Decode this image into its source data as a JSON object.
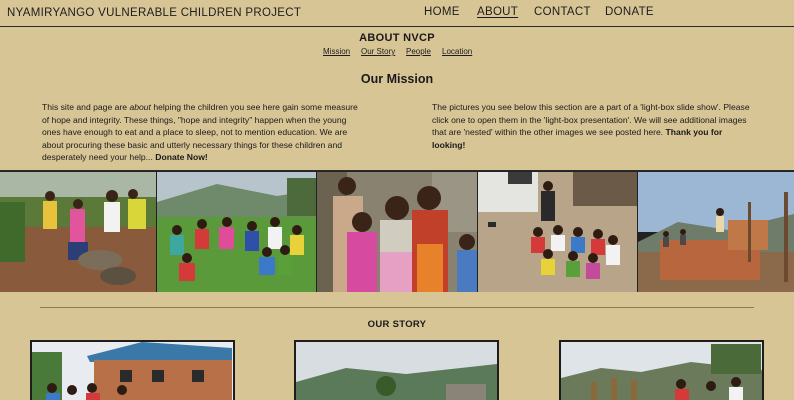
{
  "header": {
    "site_title": "NYAMIRYANGO VULNERABLE CHILDREN PROJECT",
    "nav": [
      {
        "label": "HOME",
        "active": false
      },
      {
        "label": "ABOUT",
        "active": true
      },
      {
        "label": "CONTACT",
        "active": false
      },
      {
        "label": "DONATE",
        "active": false
      }
    ]
  },
  "about": {
    "title": "ABOUT NVCP",
    "subnav": [
      "Mission",
      "Our Story",
      "People",
      "Location"
    ]
  },
  "mission": {
    "title": "Our Mission",
    "left_text_1": "This site and page are ",
    "left_text_em": "about",
    "left_text_2": " helping the children you see here gain some measure of hope and integrity. These things, \"hope and integrity\" happen when the young ones have enough to eat and a place to sleep, not to mention education. We are about procuring these basic and utterly necessary things for these children and desperately need your help... ",
    "left_strong": "Donate Now!",
    "right_text": "The pictures you see below this section are a part of a 'light-box slide show'. Please click one to open them in the 'light-box presentation'. We will see additional images that are 'nested' within the other images we see posted here. ",
    "right_strong": "Thank you for looking!"
  },
  "photos": [
    {
      "icon": "children-eating-photo"
    },
    {
      "icon": "children-on-grass-photo"
    },
    {
      "icon": "two-children-portrait-photo"
    },
    {
      "icon": "children-group-outdoor-photo"
    },
    {
      "icon": "construction-site-photo"
    }
  ],
  "story": {
    "title": "OUR STORY",
    "cards": [
      {
        "icon": "school-building-photo"
      },
      {
        "icon": "hills-landscape-photo"
      },
      {
        "icon": "children-crowd-photo"
      }
    ]
  }
}
